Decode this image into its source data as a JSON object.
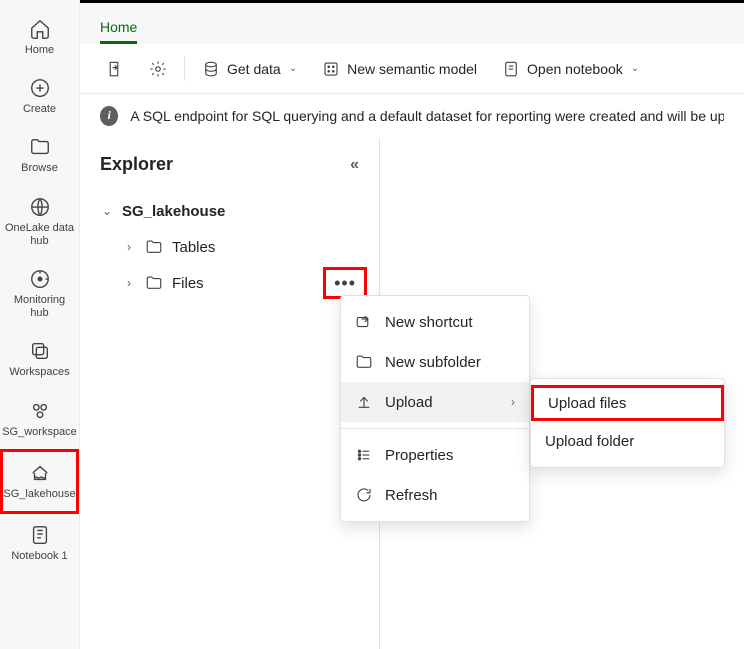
{
  "rail": {
    "items": [
      {
        "name": "home",
        "label": "Home"
      },
      {
        "name": "create",
        "label": "Create"
      },
      {
        "name": "browse",
        "label": "Browse"
      },
      {
        "name": "onelake",
        "label": "OneLake data hub"
      },
      {
        "name": "monitoring",
        "label": "Monitoring hub"
      },
      {
        "name": "workspaces",
        "label": "Workspaces"
      },
      {
        "name": "sg-workspace",
        "label": "SG_workspace"
      },
      {
        "name": "sg-lakehouse",
        "label": "SG_lakehouse"
      },
      {
        "name": "notebook1",
        "label": "Notebook 1"
      }
    ]
  },
  "header": {
    "tab": "Home"
  },
  "toolbar": {
    "get_data": "Get data",
    "new_model": "New semantic model",
    "open_notebook": "Open notebook"
  },
  "infobar": {
    "text": "A SQL endpoint for SQL querying and a default dataset for reporting were created and will be updated wi"
  },
  "explorer": {
    "title": "Explorer",
    "root": "SG_lakehouse",
    "tables": "Tables",
    "files": "Files"
  },
  "context_menu": {
    "new_shortcut": "New shortcut",
    "new_subfolder": "New subfolder",
    "upload": "Upload",
    "properties": "Properties",
    "refresh": "Refresh"
  },
  "submenu": {
    "upload_files": "Upload files",
    "upload_folder": "Upload folder"
  }
}
